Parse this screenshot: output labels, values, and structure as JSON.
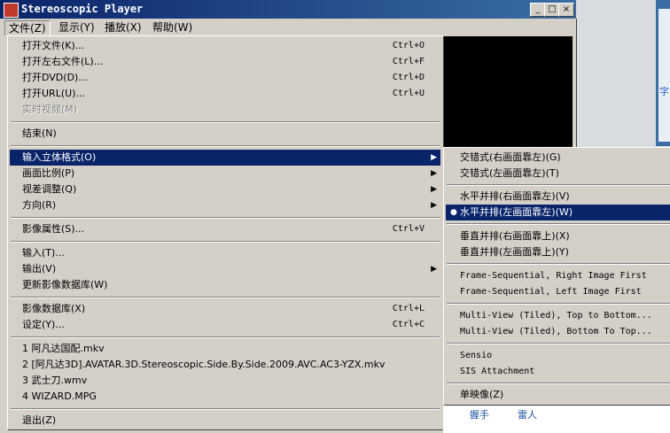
{
  "window": {
    "title": "Stereoscopic Player",
    "min_glyph": "_",
    "max_glyph": "□",
    "close_glyph": "×"
  },
  "menubar": [
    {
      "label": "文件(Z)"
    },
    {
      "label": "显示(Y)"
    },
    {
      "label": "播放(X)"
    },
    {
      "label": "帮助(W)"
    }
  ],
  "file_menu": {
    "items": [
      {
        "label": "打开文件(K)...",
        "shortcut": "Ctrl+O"
      },
      {
        "label": "打开左右文件(L)...",
        "shortcut": "Ctrl+F"
      },
      {
        "label": "打开DVD(D)...",
        "shortcut": "Ctrl+D"
      },
      {
        "label": "打开URL(U)...",
        "shortcut": "Ctrl+U"
      },
      {
        "label": "实时视频(M)",
        "disabled": true
      },
      {
        "label": "结束(N)"
      },
      {
        "label": "输入立体格式(O)",
        "submenu": true,
        "highlighted": true
      },
      {
        "label": "画面比例(P)",
        "submenu": true
      },
      {
        "label": "视差调整(Q)",
        "submenu": true
      },
      {
        "label": "方向(R)",
        "submenu": true
      },
      {
        "label": "影像属性(S)...",
        "shortcut": "Ctrl+V"
      },
      {
        "label": "输入(T)..."
      },
      {
        "label": "输出(V)",
        "submenu": true
      },
      {
        "label": "更新影像数据库(W)"
      },
      {
        "label": "影像数据库(X)",
        "shortcut": "Ctrl+L"
      },
      {
        "label": "设定(Y)...",
        "shortcut": "Ctrl+C"
      },
      {
        "label": "1 阿凡达国配.mkv"
      },
      {
        "label": "2 [阿凡达3D].AVATAR.3D.Stereoscopic.Side.By.Side.2009.AVC.AC3-YZX.mkv"
      },
      {
        "label": "3 武士刀.wmv"
      },
      {
        "label": "4 WIZARD.MPG"
      },
      {
        "label": "退出(Z)"
      }
    ],
    "arrow_glyph": "▶"
  },
  "sub_menu": {
    "items": [
      {
        "label": "交错式(右画面靠左)(G)"
      },
      {
        "label": "交错式(左画面靠左)(T)"
      },
      {
        "label": "水平并排(右画面靠左)(V)"
      },
      {
        "label": "水平并排(左画面靠左)(W)",
        "selected": true,
        "highlighted": true
      },
      {
        "label": "垂直并排(右画面靠上)(X)"
      },
      {
        "label": "垂直并排(左画面靠上)(Y)"
      },
      {
        "label": "Frame-Sequential, Right Image First"
      },
      {
        "label": "Frame-Sequential, Left Image First"
      },
      {
        "label": "Multi-View (Tiled), Top to Bottom..."
      },
      {
        "label": "Multi-View (Tiled), Bottom To Top..."
      },
      {
        "label": "Sensio"
      },
      {
        "label": "SIS Attachment"
      },
      {
        "label": "单映像(Z)"
      }
    ],
    "selected_glyph": "●"
  },
  "background": {
    "links": [
      "握手",
      "雷人"
    ],
    "side_char": "字"
  }
}
